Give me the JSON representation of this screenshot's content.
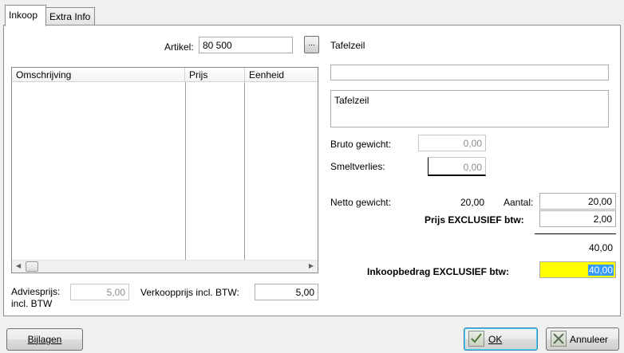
{
  "tabs": [
    {
      "label": "Inkoop",
      "active": true
    },
    {
      "label": "Extra Info",
      "active": false
    }
  ],
  "artikel": {
    "label": "Artikel:",
    "value": "80 500",
    "browse_label": "...",
    "description": "Tafelzeil"
  },
  "list": {
    "columns": [
      "Omschrijving",
      "Prijs",
      "Eenheid"
    ],
    "rows": []
  },
  "name_field": "",
  "memo_field": "Tafelzeil",
  "weights": {
    "bruto_label": "Bruto gewicht:",
    "bruto_value": "0,00",
    "smeltverlies_label": "Smeltverlies:",
    "smeltverlies_value": "0,00",
    "netto_label": "Netto gewicht:",
    "netto_value": "20,00"
  },
  "pricing": {
    "aantal_label": "Aantal:",
    "aantal_value": "20,00",
    "prijs_label": "Prijs EXCLUSIEF btw:",
    "prijs_value": "2,00",
    "subtotal": "40,00",
    "inkoop_label": "Inkoopbedrag EXCLUSIEF btw:",
    "inkoop_value": "40,00",
    "highlight_color": "#ffff00",
    "selection_color": "#3399ff"
  },
  "advies": {
    "label_line1": "Adviesprijs:",
    "label_line2": "incl. BTW",
    "value": "5,00"
  },
  "verkoop": {
    "label": "Verkoopprijs incl. BTW:",
    "value": "5,00"
  },
  "buttons": {
    "bijlagen": "Bijlagen",
    "ok": "OK",
    "annuleer": "Annuleer"
  }
}
